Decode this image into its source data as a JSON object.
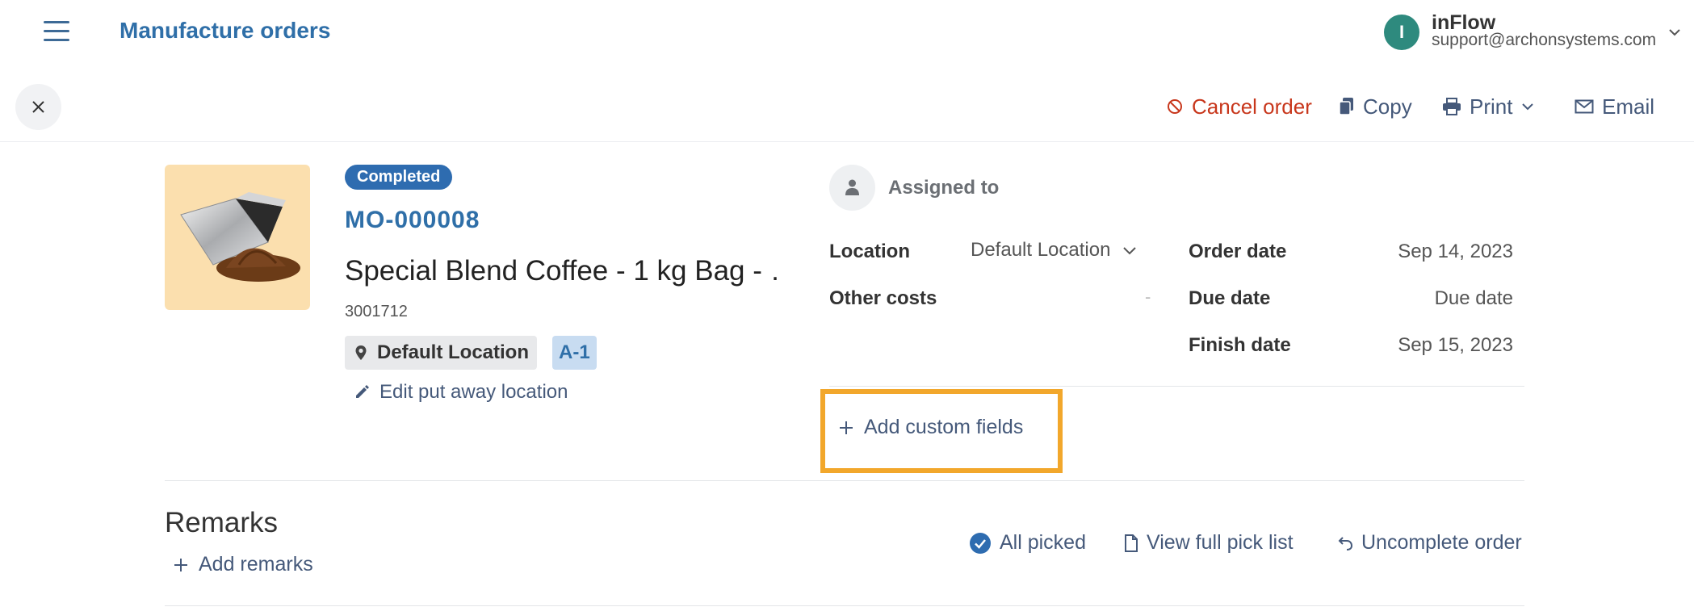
{
  "header": {
    "title": "Manufacture orders",
    "user": {
      "initial": "I",
      "name": "inFlow",
      "email": "support@archonsystems.com"
    }
  },
  "toolbar": {
    "cancel_label": "Cancel order",
    "copy_label": "Copy",
    "print_label": "Print",
    "email_label": "Email"
  },
  "order": {
    "status": "Completed",
    "number": "MO-000008",
    "product_name": "Special Blend Coffee - 1 kg Bag - …",
    "sku": "3001712",
    "location_chip": "Default Location",
    "sublocation_chip": "A-1",
    "edit_putaway_label": "Edit put away location"
  },
  "details": {
    "assigned_label": "Assigned to",
    "location_label": "Location",
    "location_value": "Default Location",
    "other_costs_label": "Other costs",
    "other_costs_value": "-",
    "order_date_label": "Order date",
    "order_date_value": "Sep 14, 2023",
    "due_date_label": "Due date",
    "due_date_value": "Due date",
    "finish_date_label": "Finish date",
    "finish_date_value": "Sep 15, 2023",
    "add_custom_label": "Add custom fields"
  },
  "remarks": {
    "title": "Remarks",
    "add_label": "Add remarks"
  },
  "actions": {
    "all_picked_label": "All picked",
    "pick_list_label": "View full pick list",
    "uncomplete_label": "Uncomplete order"
  },
  "colors": {
    "accent": "#2f6fa8",
    "danger": "#c8371c",
    "highlight": "#f2a72b",
    "avatar": "#2e8a7e"
  }
}
